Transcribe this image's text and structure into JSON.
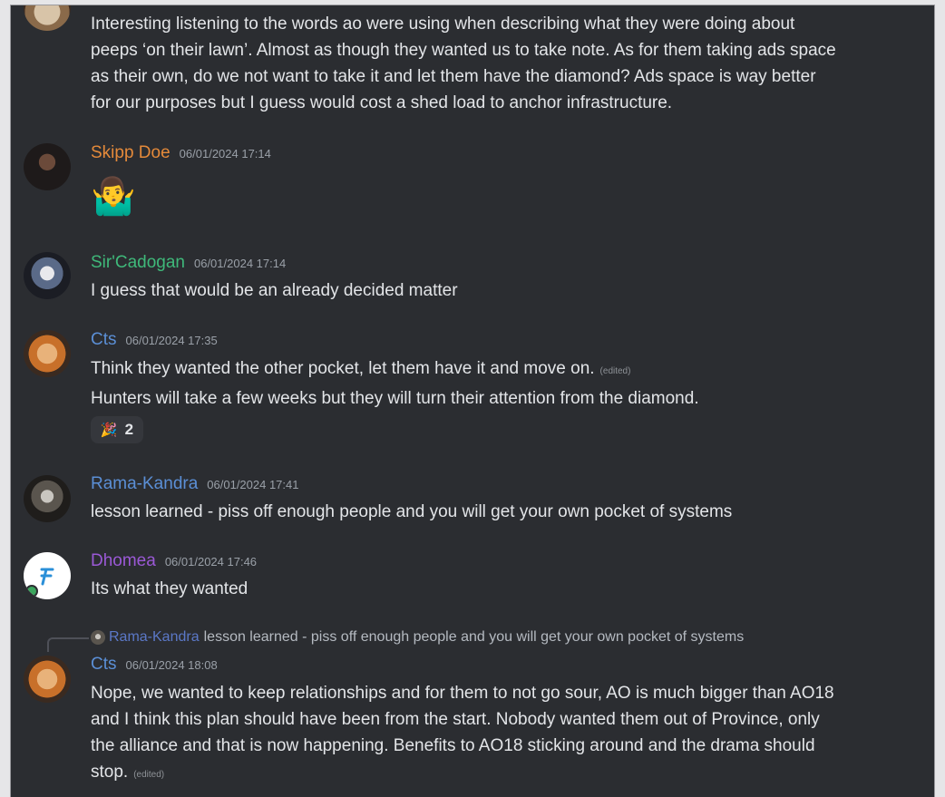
{
  "messages": {
    "m0": {
      "lines": [
        "Interesting listening to the words ao were using when describing what they were doing about",
        "peeps ‘on their lawn’. Almost as though they wanted us to take note. As for them taking ads space",
        "as their own, do we not want to take it and let them have the diamond? Ads space is way better",
        "for our purposes but I guess would cost a shed load to anchor infrastructure."
      ]
    },
    "m1": {
      "name": "Skipp Doe",
      "name_color": "#e58a3a",
      "timestamp": "06/01/2024 17:14",
      "emoji": "🤷‍♂️"
    },
    "m2": {
      "name": "Sir'Cadogan",
      "name_color": "#3fb97a",
      "timestamp": "06/01/2024 17:14",
      "line": "I guess that would be an already decided matter"
    },
    "m3": {
      "name": "Cts",
      "name_color": "#5b8fd6",
      "timestamp": "06/01/2024 17:35",
      "line1": "Think they wanted the other pocket, let them have it and move on.",
      "edited": "(edited)",
      "line2": "Hunters will take a few weeks but they will turn their attention from the diamond.",
      "reaction": {
        "icon": "🎉",
        "count": "2"
      }
    },
    "m4": {
      "name": "Rama-Kandra",
      "name_color": "#5b8fd6",
      "timestamp": "06/01/2024 17:41",
      "line": "lesson learned - piss off enough people and you will get your own pocket of systems"
    },
    "m5": {
      "name": "Dhomea",
      "name_color": "#9b59d6",
      "timestamp": "06/01/2024 17:46",
      "line": "Its what they wanted"
    },
    "m6": {
      "reply": {
        "name": "Rama-Kandra",
        "text": "lesson learned - piss off enough people and you will get your own pocket of systems"
      },
      "name": "Cts",
      "name_color": "#5b8fd6",
      "timestamp": "06/01/2024 18:08",
      "lines": [
        "Nope, we wanted to keep relationships and for them to not go sour, AO is much bigger than AO18",
        "and I think this plan should have been from the start. Nobody wanted them out of Province, only",
        "the alliance and that is now happening. Benefits to AO18 sticking around and the drama should",
        "stop."
      ],
      "edited": "(edited)"
    }
  },
  "colors": {
    "background": "#2b2d31",
    "text": "#e3e5e8",
    "timestamp": "#9aa0a8"
  }
}
